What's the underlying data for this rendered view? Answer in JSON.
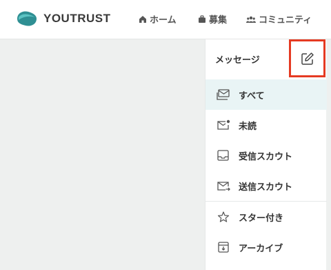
{
  "header": {
    "logo_text": "YOUTRUST",
    "nav": {
      "home": "ホーム",
      "jobs": "募集",
      "community": "コミュニティ"
    }
  },
  "panel": {
    "title": "メッセージ",
    "items": [
      {
        "label": "すべて",
        "icon": "inbox-icon",
        "active": true
      },
      {
        "label": "未読",
        "icon": "unread-mail-icon"
      },
      {
        "label": "受信スカウト",
        "icon": "tray-icon"
      },
      {
        "label": "送信スカウト",
        "icon": "send-mail-icon"
      },
      {
        "label": "スター付き",
        "icon": "star-icon"
      },
      {
        "label": "アーカイブ",
        "icon": "archive-icon"
      }
    ]
  },
  "colors": {
    "brand": "#3aa0a3",
    "highlight_border": "#e53a22",
    "active_bg": "#e9f4f5",
    "page_bg": "#eef0ef"
  }
}
